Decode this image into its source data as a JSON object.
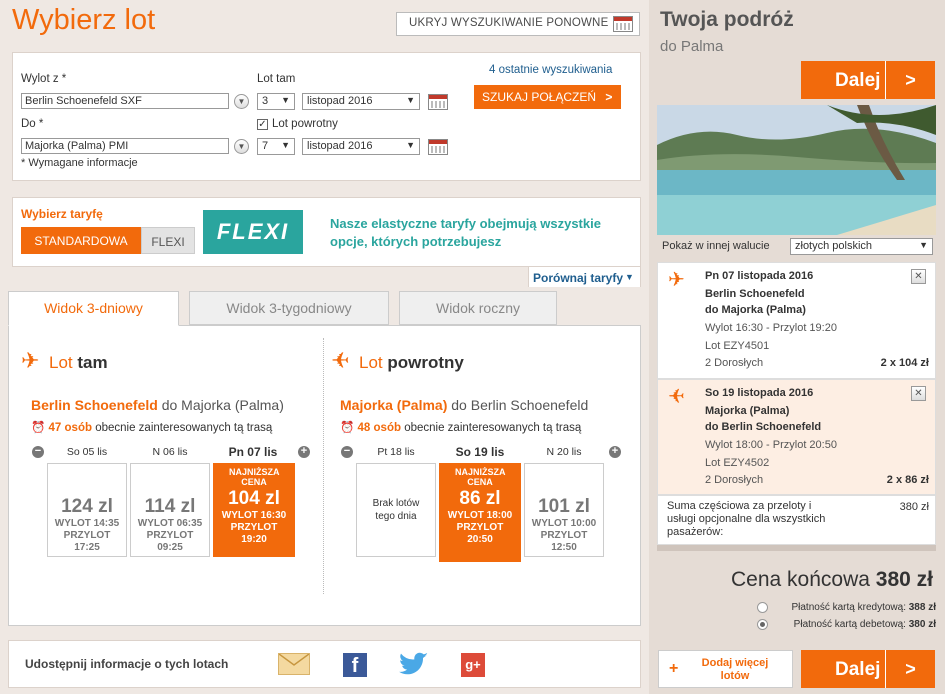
{
  "header": {
    "title": "Wybierz lot",
    "hide_search_label": "UKRYJ WYSZUKIWANIE PONOWNE"
  },
  "search": {
    "from_label": "Wylot z *",
    "from_value": "Berlin Schoenefeld SXF",
    "to_label": "Do *",
    "to_value": "Majorka (Palma) PMI",
    "required_note": "* Wymagane informacje",
    "outbound_label": "Lot tam",
    "outbound_day": "3",
    "outbound_month": "listopad 2016",
    "return_label": "Lot powrotny",
    "return_checked": "✓",
    "return_day": "7",
    "return_month": "listopad 2016",
    "recent_searches": "4 ostatnie wyszukiwania",
    "search_button": "SZUKAJ POŁĄCZEŃ"
  },
  "fare": {
    "title": "Wybierz taryfę",
    "standard": "STANDARDOWA",
    "flexi": "FLEXI",
    "flexi_logo": "FLEXI",
    "description": "Nasze elastyczne taryfy obejmują wszystkie opcje, których potrzebujesz",
    "compare": "Porównaj taryfy"
  },
  "tabs": [
    "Widok 3-dniowy",
    "Widok 3-tygodniowy",
    "Widok roczny"
  ],
  "outbound": {
    "title_a": "Lot",
    "title_b": "tam",
    "route_from": "Berlin Schoenefeld",
    "route_to": "do Majorka (Palma)",
    "interest_count": "47 osób",
    "interest_text": "obecnie zainteresowanych tą trasą",
    "days": [
      {
        "label": "So 05 lis",
        "price": "124 zl",
        "dep": "WYLOT 14:35",
        "arr_label": "PRZYLOT",
        "arr": "17:25"
      },
      {
        "label": "N 06 lis",
        "price": "114 zl",
        "dep": "WYLOT 06:35",
        "arr_label": "PRZYLOT",
        "arr": "09:25"
      },
      {
        "label": "Pn 07 lis",
        "tag": "NAJNIŻSZA CENA",
        "price": "104 zl",
        "dep": "WYLOT 16:30",
        "arr_label": "PRZYLOT",
        "arr": "19:20"
      }
    ]
  },
  "return": {
    "title_a": "Lot",
    "title_b": "powrotny",
    "route_from": "Majorka (Palma)",
    "route_to": "do Berlin Schoenefeld",
    "interest_count": "48 osób",
    "interest_text": "obecnie zainteresowanych tą trasą",
    "days": [
      {
        "label": "Pt 18 lis",
        "none": "Brak lotów tego dnia"
      },
      {
        "label": "So 19 lis",
        "tag": "NAJNIŻSZA CENA",
        "price": "86 zl",
        "dep": "WYLOT 18:00",
        "arr_label": "PRZYLOT",
        "arr": "20:50"
      },
      {
        "label": "N 20 lis",
        "price": "101 zl",
        "dep": "WYLOT 10:00",
        "arr_label": "PRZYLOT",
        "arr": "12:50"
      }
    ]
  },
  "share": {
    "label": "Udostępnij informacje o tych lotach"
  },
  "sidebar": {
    "title": "Twoja podróż",
    "destination": "do Palma",
    "next": "Dalej",
    "next_arrow": ">",
    "currency_label": "Pokaż w innej walucie",
    "currency_value": "złotych polskich",
    "legs": [
      {
        "date": "Pn 07 listopada 2016",
        "from": "Berlin Schoenefeld",
        "to": "do Majorka (Palma)",
        "times": "Wylot 16:30 - Przylot 19:20",
        "flight": "Lot EZY4501",
        "pax": "2 Dorosłych",
        "price": "2 x 104 zł"
      },
      {
        "date": "So 19 listopada 2016",
        "from": "Majorka (Palma)",
        "to": "do Berlin Schoenefeld",
        "times": "Wylot 18:00 - Przylot 20:50",
        "flight": "Lot EZY4502",
        "pax": "2 Dorosłych",
        "price": "2 x 86 zł"
      }
    ],
    "subtotal_label": "Suma częściowa za przeloty i usługi opcjonalne dla wszystkich pasażerów:",
    "subtotal_value": "380 zł",
    "final_label": "Cena końcowa",
    "final_value": "380 zł",
    "pay_credit": "Płatność kartą kredytową:",
    "pay_credit_value": "388 zł",
    "pay_debit": "Płatność kartą debetową:",
    "pay_debit_value": "380 zł",
    "add_more": "Dodaj więcej lotów",
    "add_plus": "+"
  }
}
